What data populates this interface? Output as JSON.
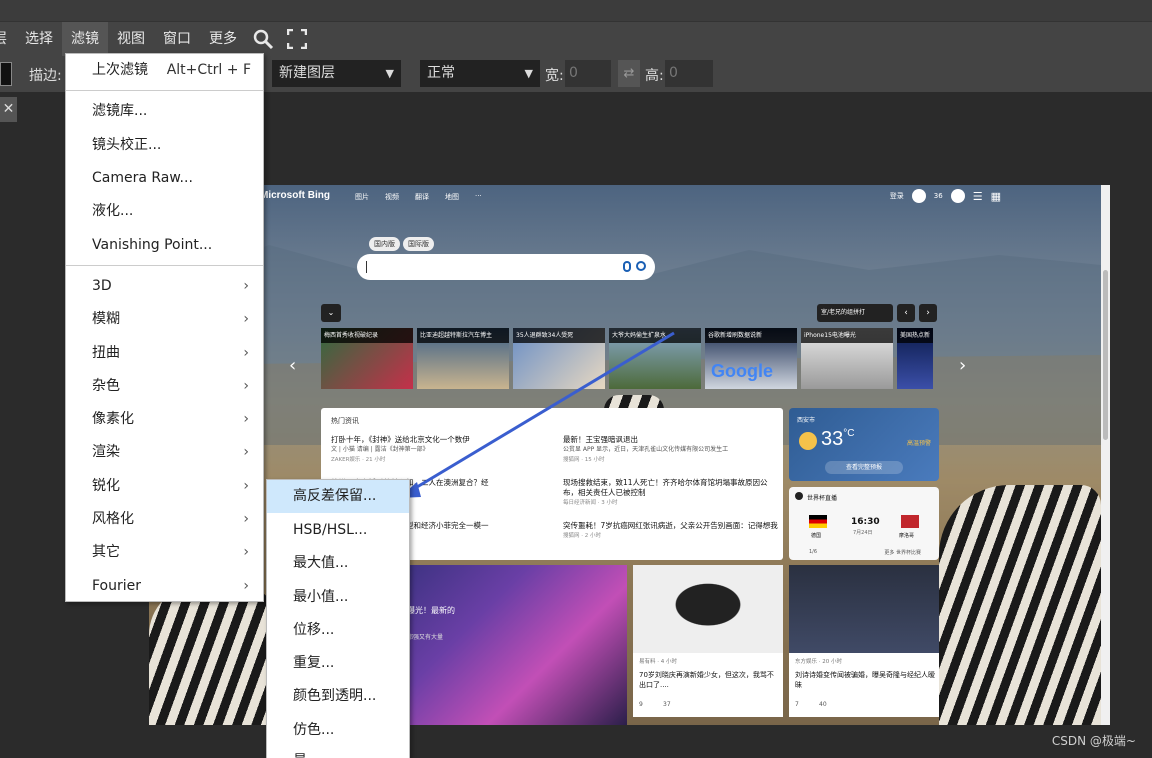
{
  "menubar": {
    "partial_item": "层",
    "items": [
      "选择",
      "滤镜",
      "视图",
      "窗口",
      "更多"
    ],
    "icons": [
      "search-icon",
      "fullscreen-icon"
    ]
  },
  "options": {
    "stroke_label": "描边:",
    "layer_select": "新建图层",
    "mode_select": "正常",
    "width_label": "宽:",
    "width_value": "0",
    "height_label": "高:",
    "height_value": "0"
  },
  "filter_menu": {
    "last_filter": {
      "label": "上次滤镜",
      "shortcut": "Alt+Ctrl + F"
    },
    "items": [
      "滤镜库...",
      "镜头校正...",
      "Camera Raw...",
      "液化...",
      "Vanishing Point..."
    ],
    "submenus": [
      "3D",
      "模糊",
      "扭曲",
      "杂色",
      "像素化",
      "渲染",
      "锐化",
      "风格化",
      "其它",
      "Fourier"
    ]
  },
  "other_submenu": {
    "items": [
      "高反差保留...",
      "HSB/HSL...",
      "最大值...",
      "最小值...",
      "位移...",
      "重复...",
      "颜色到透明...",
      "仿色...",
      "最..."
    ],
    "highlighted": "高反差保留..."
  },
  "canvas": {
    "bing_logo": "Microsoft Bing",
    "nav": [
      "图片",
      "视频",
      "翻译",
      "地图",
      "···"
    ],
    "login": "登录",
    "points": "36",
    "region_tabs": [
      "国内版",
      "国际版"
    ],
    "location": "室/老兄的组拼打",
    "news_tiles": [
      "梅西首秀收视破纪录",
      "比亚迪超越特斯拉汽车博主",
      "35人退群致34人受死",
      "大爷大妈偷生扩泉水",
      "谷歌新增刷数据说新",
      "iPhone15电池曝光",
      "美国热点新"
    ],
    "hot_header": "热门资讯",
    "news": [
      {
        "title": "打卧十年，《封神》送给北京文化一个数伊",
        "sub": "文 | 小猫 请编 | 露洁《封神第一部》",
        "meta": "ZAKER娱乐 · 21 小时"
      },
      {
        "title": "最新！王宝强暗讽退出",
        "sub": "公贫显 APP 显示，近日，天津孔雀山文化传媒有限公司发生工",
        "meta": "搜狐网 · 15 小时"
      },
      {
        "title": "外媒曝光离婚后的林心如，二人在澳洲复合？经",
        "sub": "",
        "meta": ""
      },
      {
        "title": "现场搜救结束，致11人死亡！齐齐哈尔体育馆坍塌事故原因公布，相关责任人已被控制",
        "sub": "",
        "meta": "每日经济新闻 · 3 小时"
      },
      {
        "title": "王炸组，晚上拉跑，脸型和经济小菲完全一模一",
        "sub": "",
        "meta": ""
      },
      {
        "title": "突传噩耗！7岁抗癌网红张讯病逝，父亲公开告别画面：记得想我",
        "sub": "",
        "meta": "搜狐网 · 2 小时"
      }
    ],
    "weather": {
      "city": "西安市",
      "temp": "33",
      "unit": "°C",
      "alert": "高温预警",
      "button": "查看完整预报"
    },
    "sports": {
      "header": "世界杯直播",
      "time": "16:30",
      "date": "7月24日",
      "team_a": "德国",
      "team_b": "摩洛哥",
      "page": "1/6",
      "more": "更多 世界杯比赛"
    },
    "story_left": {
      "title": "曝光！最新的",
      "sub": "都强又有大量"
    },
    "story_mid": {
      "source": "易有料 · 4 小时",
      "title": "70岁刘晓庆再演新婚少女，但这次，我骂不出口了....",
      "likes": "9",
      "comments": "37"
    },
    "story_right": {
      "source": "东方娱乐 · 20 小时",
      "title": "刘诗诗婚变传闻被骗婚，曝吴奇隆与经纪人暧昧",
      "likes": "7",
      "comments": "40"
    }
  },
  "watermark": "CSDN @极端~",
  "colors": {
    "menubar": "#444444",
    "menu_highlight": "#cfe8fc",
    "arrow": "#3a5ecf"
  }
}
